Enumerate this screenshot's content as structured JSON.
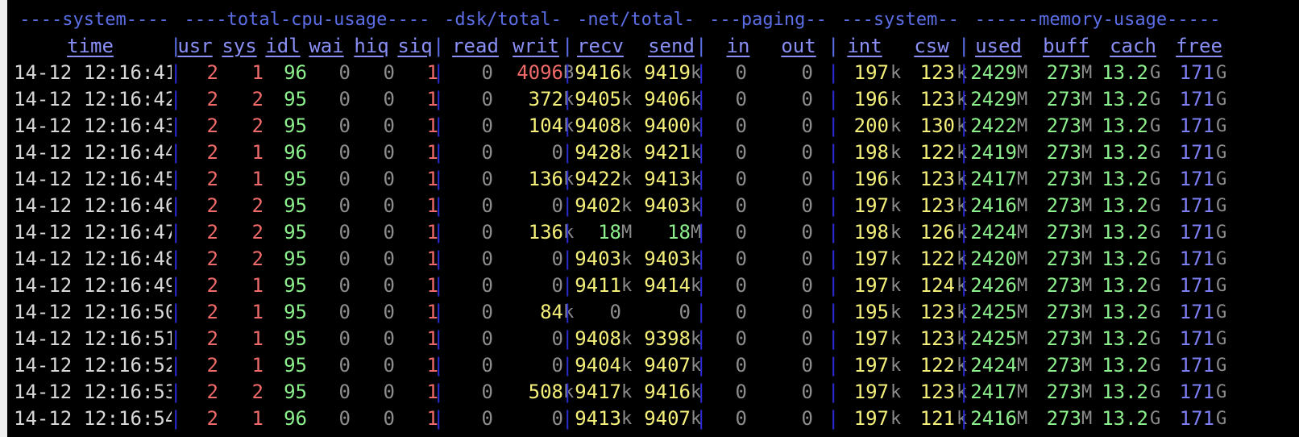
{
  "colors": {
    "background": "#000000",
    "group_header": "#5b6ee6",
    "column_header": "#8a8ff5",
    "separator": "#2b2bd4",
    "time": "#d8d8d8",
    "red": "#f06a6a",
    "green": "#8cf08c",
    "zero": "#8c8c8c",
    "yellow": "#f5f07a",
    "unit": "#8c8c8c",
    "free": "#7d7ff5"
  },
  "group_headers": [
    "----system----",
    "----total-cpu-usage----",
    "-dsk/total-",
    "-net/total-",
    "---paging--",
    "---system--",
    "------memory-usage-----"
  ],
  "columns": [
    "time",
    "usr",
    "sys",
    "idl",
    "wai",
    "hiq",
    "siq",
    "read",
    "writ",
    "recv",
    "send",
    "in",
    "out",
    "int",
    "csw",
    "used",
    "buff",
    "cach",
    "free"
  ],
  "rows": [
    {
      "time": "14-12 12:16:41",
      "usr": "2",
      "sys": "1",
      "idl": "96",
      "wai": "0",
      "hiq": "0",
      "siq": "1",
      "read": "0",
      "writ": "4096",
      "writ_u": "B",
      "recv": "9416",
      "recv_u": "k",
      "send": "9419",
      "send_u": "k",
      "in": "0",
      "out": "0",
      "int": "197",
      "int_u": "k",
      "csw": "123",
      "csw_u": "k",
      "used": "2429",
      "used_u": "M",
      "buff": "273",
      "buff_u": "M",
      "cach": "13.2",
      "cach_u": "G",
      "free": "171",
      "free_u": "G"
    },
    {
      "time": "14-12 12:16:42",
      "usr": "2",
      "sys": "2",
      "idl": "95",
      "wai": "0",
      "hiq": "0",
      "siq": "1",
      "read": "0",
      "writ": "372",
      "writ_u": "k",
      "recv": "9405",
      "recv_u": "k",
      "send": "9406",
      "send_u": "k",
      "in": "0",
      "out": "0",
      "int": "196",
      "int_u": "k",
      "csw": "123",
      "csw_u": "k",
      "used": "2429",
      "used_u": "M",
      "buff": "273",
      "buff_u": "M",
      "cach": "13.2",
      "cach_u": "G",
      "free": "171",
      "free_u": "G"
    },
    {
      "time": "14-12 12:16:43",
      "usr": "2",
      "sys": "2",
      "idl": "95",
      "wai": "0",
      "hiq": "0",
      "siq": "1",
      "read": "0",
      "writ": "104",
      "writ_u": "k",
      "recv": "9408",
      "recv_u": "k",
      "send": "9400",
      "send_u": "k",
      "in": "0",
      "out": "0",
      "int": "200",
      "int_u": "k",
      "csw": "130",
      "csw_u": "k",
      "used": "2422",
      "used_u": "M",
      "buff": "273",
      "buff_u": "M",
      "cach": "13.2",
      "cach_u": "G",
      "free": "171",
      "free_u": "G"
    },
    {
      "time": "14-12 12:16:44",
      "usr": "2",
      "sys": "1",
      "idl": "96",
      "wai": "0",
      "hiq": "0",
      "siq": "1",
      "read": "0",
      "writ": "0",
      "writ_u": "",
      "recv": "9428",
      "recv_u": "k",
      "send": "9421",
      "send_u": "k",
      "in": "0",
      "out": "0",
      "int": "198",
      "int_u": "k",
      "csw": "122",
      "csw_u": "k",
      "used": "2419",
      "used_u": "M",
      "buff": "273",
      "buff_u": "M",
      "cach": "13.2",
      "cach_u": "G",
      "free": "171",
      "free_u": "G"
    },
    {
      "time": "14-12 12:16:45",
      "usr": "2",
      "sys": "1",
      "idl": "95",
      "wai": "0",
      "hiq": "0",
      "siq": "1",
      "read": "0",
      "writ": "136",
      "writ_u": "k",
      "recv": "9422",
      "recv_u": "k",
      "send": "9413",
      "send_u": "k",
      "in": "0",
      "out": "0",
      "int": "196",
      "int_u": "k",
      "csw": "123",
      "csw_u": "k",
      "used": "2417",
      "used_u": "M",
      "buff": "273",
      "buff_u": "M",
      "cach": "13.2",
      "cach_u": "G",
      "free": "171",
      "free_u": "G"
    },
    {
      "time": "14-12 12:16:46",
      "usr": "2",
      "sys": "2",
      "idl": "95",
      "wai": "0",
      "hiq": "0",
      "siq": "1",
      "read": "0",
      "writ": "0",
      "writ_u": "",
      "recv": "9402",
      "recv_u": "k",
      "send": "9403",
      "send_u": "k",
      "in": "0",
      "out": "0",
      "int": "197",
      "int_u": "k",
      "csw": "123",
      "csw_u": "k",
      "used": "2416",
      "used_u": "M",
      "buff": "273",
      "buff_u": "M",
      "cach": "13.2",
      "cach_u": "G",
      "free": "171",
      "free_u": "G"
    },
    {
      "time": "14-12 12:16:47",
      "usr": "2",
      "sys": "2",
      "idl": "95",
      "wai": "0",
      "hiq": "0",
      "siq": "1",
      "read": "0",
      "writ": "136",
      "writ_u": "k",
      "recv": "18",
      "recv_u": "M",
      "send": "18",
      "send_u": "M",
      "in": "0",
      "out": "0",
      "int": "198",
      "int_u": "k",
      "csw": "126",
      "csw_u": "k",
      "used": "2424",
      "used_u": "M",
      "buff": "273",
      "buff_u": "M",
      "cach": "13.2",
      "cach_u": "G",
      "free": "171",
      "free_u": "G"
    },
    {
      "time": "14-12 12:16:48",
      "usr": "2",
      "sys": "2",
      "idl": "95",
      "wai": "0",
      "hiq": "0",
      "siq": "1",
      "read": "0",
      "writ": "0",
      "writ_u": "",
      "recv": "9403",
      "recv_u": "k",
      "send": "9403",
      "send_u": "k",
      "in": "0",
      "out": "0",
      "int": "197",
      "int_u": "k",
      "csw": "122",
      "csw_u": "k",
      "used": "2420",
      "used_u": "M",
      "buff": "273",
      "buff_u": "M",
      "cach": "13.2",
      "cach_u": "G",
      "free": "171",
      "free_u": "G"
    },
    {
      "time": "14-12 12:16:49",
      "usr": "2",
      "sys": "1",
      "idl": "95",
      "wai": "0",
      "hiq": "0",
      "siq": "1",
      "read": "0",
      "writ": "0",
      "writ_u": "",
      "recv": "9411",
      "recv_u": "k",
      "send": "9414",
      "send_u": "k",
      "in": "0",
      "out": "0",
      "int": "197",
      "int_u": "k",
      "csw": "124",
      "csw_u": "k",
      "used": "2426",
      "used_u": "M",
      "buff": "273",
      "buff_u": "M",
      "cach": "13.2",
      "cach_u": "G",
      "free": "171",
      "free_u": "G"
    },
    {
      "time": "14-12 12:16:50",
      "usr": "2",
      "sys": "1",
      "idl": "95",
      "wai": "0",
      "hiq": "0",
      "siq": "1",
      "read": "0",
      "writ": "84",
      "writ_u": "k",
      "recv": "0",
      "recv_u": "",
      "send": "0",
      "send_u": "",
      "in": "0",
      "out": "0",
      "int": "195",
      "int_u": "k",
      "csw": "123",
      "csw_u": "k",
      "used": "2425",
      "used_u": "M",
      "buff": "273",
      "buff_u": "M",
      "cach": "13.2",
      "cach_u": "G",
      "free": "171",
      "free_u": "G"
    },
    {
      "time": "14-12 12:16:51",
      "usr": "2",
      "sys": "1",
      "idl": "95",
      "wai": "0",
      "hiq": "0",
      "siq": "1",
      "read": "0",
      "writ": "0",
      "writ_u": "",
      "recv": "9408",
      "recv_u": "k",
      "send": "9398",
      "send_u": "k",
      "in": "0",
      "out": "0",
      "int": "197",
      "int_u": "k",
      "csw": "123",
      "csw_u": "k",
      "used": "2425",
      "used_u": "M",
      "buff": "273",
      "buff_u": "M",
      "cach": "13.2",
      "cach_u": "G",
      "free": "171",
      "free_u": "G"
    },
    {
      "time": "14-12 12:16:52",
      "usr": "2",
      "sys": "1",
      "idl": "95",
      "wai": "0",
      "hiq": "0",
      "siq": "1",
      "read": "0",
      "writ": "0",
      "writ_u": "",
      "recv": "9404",
      "recv_u": "k",
      "send": "9407",
      "send_u": "k",
      "in": "0",
      "out": "0",
      "int": "197",
      "int_u": "k",
      "csw": "122",
      "csw_u": "k",
      "used": "2424",
      "used_u": "M",
      "buff": "273",
      "buff_u": "M",
      "cach": "13.2",
      "cach_u": "G",
      "free": "171",
      "free_u": "G"
    },
    {
      "time": "14-12 12:16:53",
      "usr": "2",
      "sys": "2",
      "idl": "95",
      "wai": "0",
      "hiq": "0",
      "siq": "1",
      "read": "0",
      "writ": "508",
      "writ_u": "k",
      "recv": "9417",
      "recv_u": "k",
      "send": "9416",
      "send_u": "k",
      "in": "0",
      "out": "0",
      "int": "197",
      "int_u": "k",
      "csw": "123",
      "csw_u": "k",
      "used": "2417",
      "used_u": "M",
      "buff": "273",
      "buff_u": "M",
      "cach": "13.2",
      "cach_u": "G",
      "free": "171",
      "free_u": "G"
    },
    {
      "time": "14-12 12:16:54",
      "usr": "2",
      "sys": "1",
      "idl": "96",
      "wai": "0",
      "hiq": "0",
      "siq": "1",
      "read": "0",
      "writ": "0",
      "writ_u": "",
      "recv": "9413",
      "recv_u": "k",
      "send": "9407",
      "send_u": "k",
      "in": "0",
      "out": "0",
      "int": "197",
      "int_u": "k",
      "csw": "121",
      "csw_u": "k",
      "used": "2416",
      "used_u": "M",
      "buff": "273",
      "buff_u": "M",
      "cach": "13.2",
      "cach_u": "G",
      "free": "171",
      "free_u": "G"
    }
  ]
}
